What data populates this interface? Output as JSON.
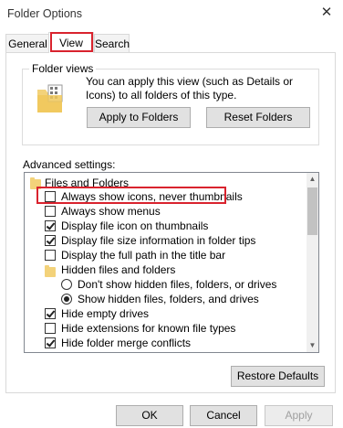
{
  "window": {
    "title": "Folder Options",
    "close_glyph": "✕"
  },
  "tabs": [
    {
      "label": "General"
    },
    {
      "label": "View"
    },
    {
      "label": "Search"
    }
  ],
  "folder_views": {
    "group_label": "Folder views",
    "description": "You can apply this view (such as Details or Icons) to all folders of this type.",
    "apply_button": "Apply to Folders",
    "reset_button": "Reset Folders"
  },
  "advanced": {
    "label": "Advanced settings:",
    "items": [
      {
        "kind": "folder",
        "label": "Files and Folders"
      },
      {
        "kind": "checkbox",
        "label": "Always show icons, never thumbnails",
        "checked": false
      },
      {
        "kind": "checkbox",
        "label": "Always show menus",
        "checked": false
      },
      {
        "kind": "checkbox",
        "label": "Display file icon on thumbnails",
        "checked": true
      },
      {
        "kind": "checkbox",
        "label": "Display file size information in folder tips",
        "checked": true
      },
      {
        "kind": "checkbox",
        "label": "Display the full path in the title bar",
        "checked": false
      },
      {
        "kind": "folder",
        "label": "Hidden files and folders"
      },
      {
        "kind": "radio",
        "label": "Don't show hidden files, folders, or drives",
        "checked": false
      },
      {
        "kind": "radio",
        "label": "Show hidden files, folders, and drives",
        "checked": true
      },
      {
        "kind": "checkbox",
        "label": "Hide empty drives",
        "checked": true
      },
      {
        "kind": "checkbox",
        "label": "Hide extensions for known file types",
        "checked": false
      },
      {
        "kind": "checkbox",
        "label": "Hide folder merge conflicts",
        "checked": true
      }
    ],
    "restore_button": "Restore Defaults"
  },
  "footer": {
    "ok": "OK",
    "cancel": "Cancel",
    "apply": "Apply"
  },
  "colors": {
    "highlight": "#d9232e",
    "folder": "#f3d27a"
  }
}
